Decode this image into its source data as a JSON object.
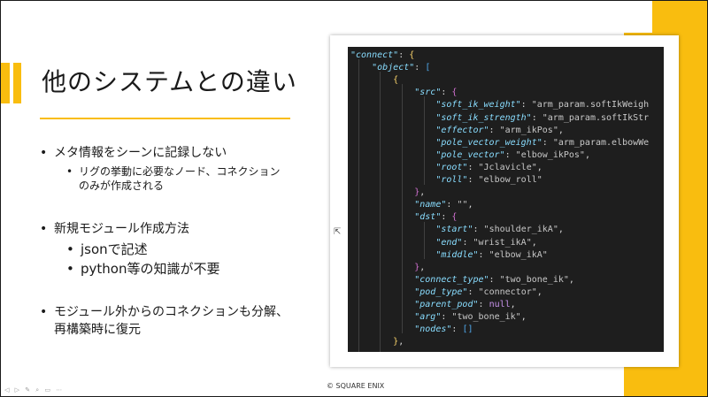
{
  "slide": {
    "title": "他のシステムとの違い",
    "footer": "© SQUARE ENIX",
    "toolbar_glyphs": "◁ ▷ ✎ ⌕ ▭ ⋯",
    "colors": {
      "accent": "#f9bd0f",
      "code_bg": "#1e1e1e"
    },
    "bullets": [
      {
        "text": "メタ情報をシーンに記録しない",
        "sub": [
          "リグの挙動に必要なノード、コネクション のみが作成される"
        ]
      },
      {
        "text": "新規モジュール作成方法",
        "sub": [
          "jsonで記述",
          "python等の知識が不要"
        ]
      },
      {
        "text": "モジュール外からのコネクションも分解、 再構築時に復元",
        "sub": []
      }
    ],
    "sub1_line1": "リグの挙動に必要なノード、コネクション",
    "sub1_line2": "のみが作成される",
    "b3_line1": "モジュール外からのコネクションも分解、",
    "b3_line2": "再構築時に復元"
  },
  "code": {
    "lines": [
      "\"connect\": {",
      "    \"object\": [",
      "        {",
      "            \"src\": {",
      "                \"soft_ik_weight\": \"arm_param.softIkWeigh",
      "                \"soft_ik_strength\": \"arm_param.softIkStr",
      "                \"effector\": \"arm_ikPos\",",
      "                \"pole_vector_weight\": \"arm_param.elbowWe",
      "                \"pole_vector\": \"elbow_ikPos\",",
      "                \"root\": \"Jclavicle\",",
      "                \"roll\": \"elbow_roll\"",
      "            },",
      "            \"name\": \"\",",
      "            \"dst\": {",
      "                \"start\": \"shoulder_ikA\",",
      "                \"end\": \"wrist_ikA\",",
      "                \"middle\": \"elbow_ikA\"",
      "            },",
      "            \"connect_type\": \"two_bone_ik\",",
      "            \"pod_type\": \"connector\",",
      "            \"parent_pod\": null,",
      "            \"arg\": \"two_bone_ik\",",
      "            \"nodes\": []",
      "        },"
    ]
  }
}
